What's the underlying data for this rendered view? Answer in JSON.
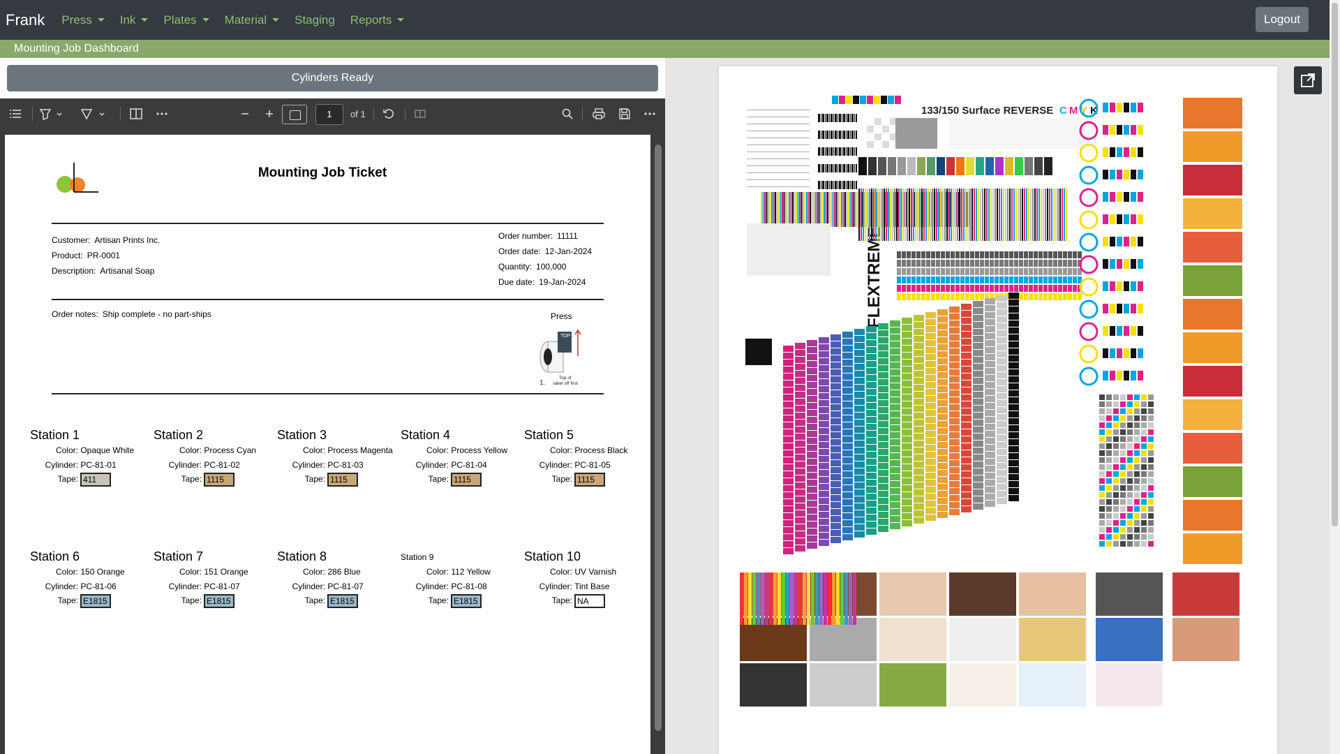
{
  "nav": {
    "brand": "Frank",
    "items": [
      {
        "label": "Press",
        "dropdown": true
      },
      {
        "label": "Ink",
        "dropdown": true
      },
      {
        "label": "Plates",
        "dropdown": true
      },
      {
        "label": "Material",
        "dropdown": true
      },
      {
        "label": "Staging",
        "dropdown": false
      },
      {
        "label": "Reports",
        "dropdown": true
      }
    ],
    "logout": "Logout"
  },
  "subheader": "Mounting Job Dashboard",
  "status": "Cylinders Ready",
  "pdf_toolbar": {
    "page_number": "1",
    "page_of": "of 1"
  },
  "ticket": {
    "title": "Mounting Job Ticket",
    "customer_label": "Customer:",
    "customer": "Artisan Prints Inc.",
    "product_label": "Product:",
    "product": "PR-0001",
    "description_label": "Description:",
    "description": "Artisanal Soap",
    "order_number_label": "Order number:",
    "order_number": "11111",
    "order_date_label": "Order date:",
    "order_date": "12-Jan-2024",
    "quantity_label": "Quantity:",
    "quantity": "100,000",
    "due_date_label": "Due date:",
    "due_date": "19-Jan-2024",
    "order_notes_label": "Order notes:",
    "order_notes": "Ship complete - no part-ships",
    "press_label": "Press",
    "press_art_step": "1.",
    "press_art_caption_1": "Top of",
    "press_art_caption_2": "label off first",
    "press_art_top": "TOP",
    "color_label": "Color:",
    "cylinder_label": "Cylinder:",
    "tape_label": "Tape:"
  },
  "stations": [
    {
      "title": "Station 1",
      "color": "Opaque White",
      "cylinder": "PC-81-01",
      "tape": "411",
      "tape_color": "#c8c4bc"
    },
    {
      "title": "Station 2",
      "color": "Process Cyan",
      "cylinder": "PC-81-02",
      "tape": "1115",
      "tape_color": "#c9a67a"
    },
    {
      "title": "Station 3",
      "color": "Process Magenta",
      "cylinder": "PC-81-03",
      "tape": "1115",
      "tape_color": "#c9a67a"
    },
    {
      "title": "Station 4",
      "color": "Process Yellow",
      "cylinder": "PC-81-04",
      "tape": "1115",
      "tape_color": "#c9a67a"
    },
    {
      "title": "Station 5",
      "color": "Process Black",
      "cylinder": "PC-81-05",
      "tape": "1115",
      "tape_color": "#c9a67a"
    },
    {
      "title": "Station 6",
      "color": "150 Orange",
      "cylinder": "PC-81-06",
      "tape": "E1815",
      "tape_color": "#9bb8c8"
    },
    {
      "title": "Station 7",
      "color": "151 Orange",
      "cylinder": "PC-81-07",
      "tape": "E1815",
      "tape_color": "#9bb8c8"
    },
    {
      "title": "Station 8",
      "color": "286 Blue",
      "cylinder": "PC-81-07",
      "tape": "E1815",
      "tape_color": "#9bb8c8"
    },
    {
      "title": "Station 9",
      "color": "112 Yellow",
      "cylinder": "PC-81-08",
      "tape": "E1815",
      "tape_color": "#9bb8c8"
    },
    {
      "title": "Station 10",
      "color": "UV Varnish",
      "cylinder": "Tint Base",
      "tape": "NA",
      "tape_color": "#ffffff"
    }
  ],
  "preview": {
    "heading": "133/150 Surface REVERSE",
    "heading_c": "C",
    "heading_m": "M",
    "heading_y": "Y",
    "heading_k": "K",
    "brand": "FLEXTREME"
  }
}
